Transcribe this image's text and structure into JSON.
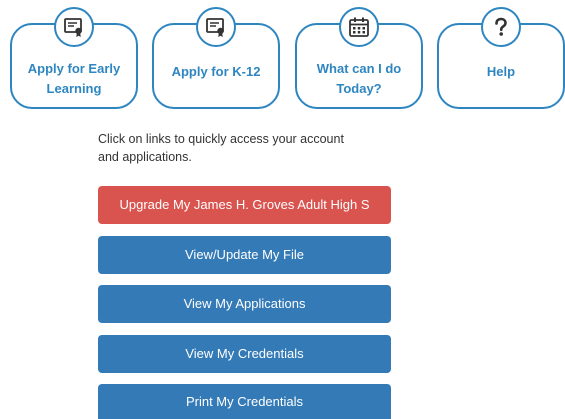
{
  "cards": [
    {
      "label_line1": "Apply for Early",
      "label_line2": "Learning",
      "icon": "certificate-icon"
    },
    {
      "label_line1": "Apply for K-12",
      "label_line2": "",
      "icon": "certificate-icon"
    },
    {
      "label_line1": "What can I do",
      "label_line2": "Today?",
      "icon": "calendar-icon"
    },
    {
      "label_line1": "Help",
      "label_line2": "",
      "icon": "question-icon"
    }
  ],
  "intro": {
    "line1": "Click on links to quickly access your account",
    "line2": "and applications."
  },
  "buttons": {
    "upgrade": "Upgrade My James H. Groves Adult High S",
    "view_update": "View/Update My File",
    "applications": "View My Applications",
    "credentials": "View My Credentials",
    "print": "Print My Credentials"
  },
  "colors": {
    "accent": "#2e86c1",
    "danger": "#d9534f",
    "primary": "#337ab7"
  }
}
